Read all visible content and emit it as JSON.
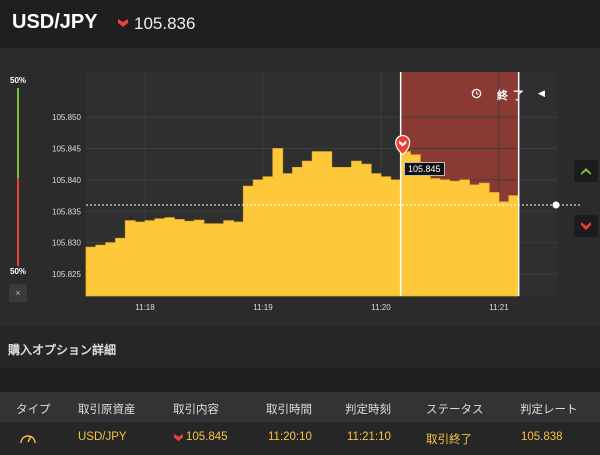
{
  "header": {
    "pair": "USD/JPY",
    "rate": "105.836",
    "direction_icon": "down-arrow-icon",
    "direction_color": "#e8403a"
  },
  "chart": {
    "y_ticks": [
      "105.850",
      "105.845",
      "105.840",
      "105.835",
      "105.830",
      "105.825"
    ],
    "x_ticks": [
      "11:18",
      "11:19",
      "11:20",
      "11:21"
    ],
    "gauge_top": "50%",
    "gauge_bottom": "50%",
    "gauge_close": "×",
    "expire_label": "終 了",
    "tooltip": "105.845",
    "fill_color": "#fdc93b",
    "expire_zone_color": "#8a3a32",
    "high_color": "#7dc142",
    "low_color": "#e8403a"
  },
  "chart_data": {
    "type": "area",
    "x": [
      "11:17:30",
      "11:17:35",
      "11:17:40",
      "11:17:45",
      "11:17:50",
      "11:17:55",
      "11:18:00",
      "11:18:05",
      "11:18:10",
      "11:18:15",
      "11:18:20",
      "11:18:25",
      "11:18:30",
      "11:18:35",
      "11:18:40",
      "11:18:45",
      "11:18:50",
      "11:18:55",
      "11:19:00",
      "11:19:05",
      "11:19:10",
      "11:19:15",
      "11:19:20",
      "11:19:25",
      "11:19:30",
      "11:19:35",
      "11:19:40",
      "11:19:45",
      "11:19:50",
      "11:19:55",
      "11:20:00",
      "11:20:05",
      "11:20:10",
      "11:20:15",
      "11:20:20",
      "11:20:25",
      "11:20:30",
      "11:20:35",
      "11:20:40",
      "11:20:45",
      "11:20:50",
      "11:20:55",
      "11:21:00",
      "11:21:05",
      "11:21:10"
    ],
    "values": [
      105.8293,
      105.8296,
      105.83,
      105.8307,
      105.8335,
      105.8333,
      105.8335,
      105.8338,
      105.834,
      105.8337,
      105.8334,
      105.8336,
      105.833,
      105.833,
      105.8335,
      105.8333,
      105.839,
      105.84,
      105.8405,
      105.845,
      105.841,
      105.842,
      105.843,
      105.8445,
      105.8445,
      105.842,
      105.842,
      105.843,
      105.8425,
      105.841,
      105.8405,
      105.84,
      105.8445,
      105.844,
      105.841,
      105.8402,
      105.84,
      105.8398,
      105.84,
      105.8392,
      105.8395,
      105.838,
      105.8365,
      105.8375,
      105.838
    ],
    "title": "",
    "xlabel": "",
    "ylabel": "",
    "ylim": [
      105.8215,
      105.8572
    ],
    "current_rate": 105.836,
    "purchase_rate": 105.845,
    "purchase_time": "11:20:10",
    "expiry_time": "11:21:10",
    "grid": true
  },
  "options": {
    "section_title": "購入オプション詳細",
    "columns": [
      "タイプ",
      "取引原資産",
      "取引内容",
      "取引時間",
      "判定時刻",
      "ステータス",
      "判定レート"
    ],
    "rows": [
      {
        "type_icon": "gauge-icon",
        "asset": "USD/JPY",
        "direction_icon": "down-arrow-icon",
        "content": "105.845",
        "trade_time": "11:20:10",
        "judge_time": "11:21:10",
        "status": "取引終了",
        "judge_rate": "105.838"
      }
    ]
  }
}
